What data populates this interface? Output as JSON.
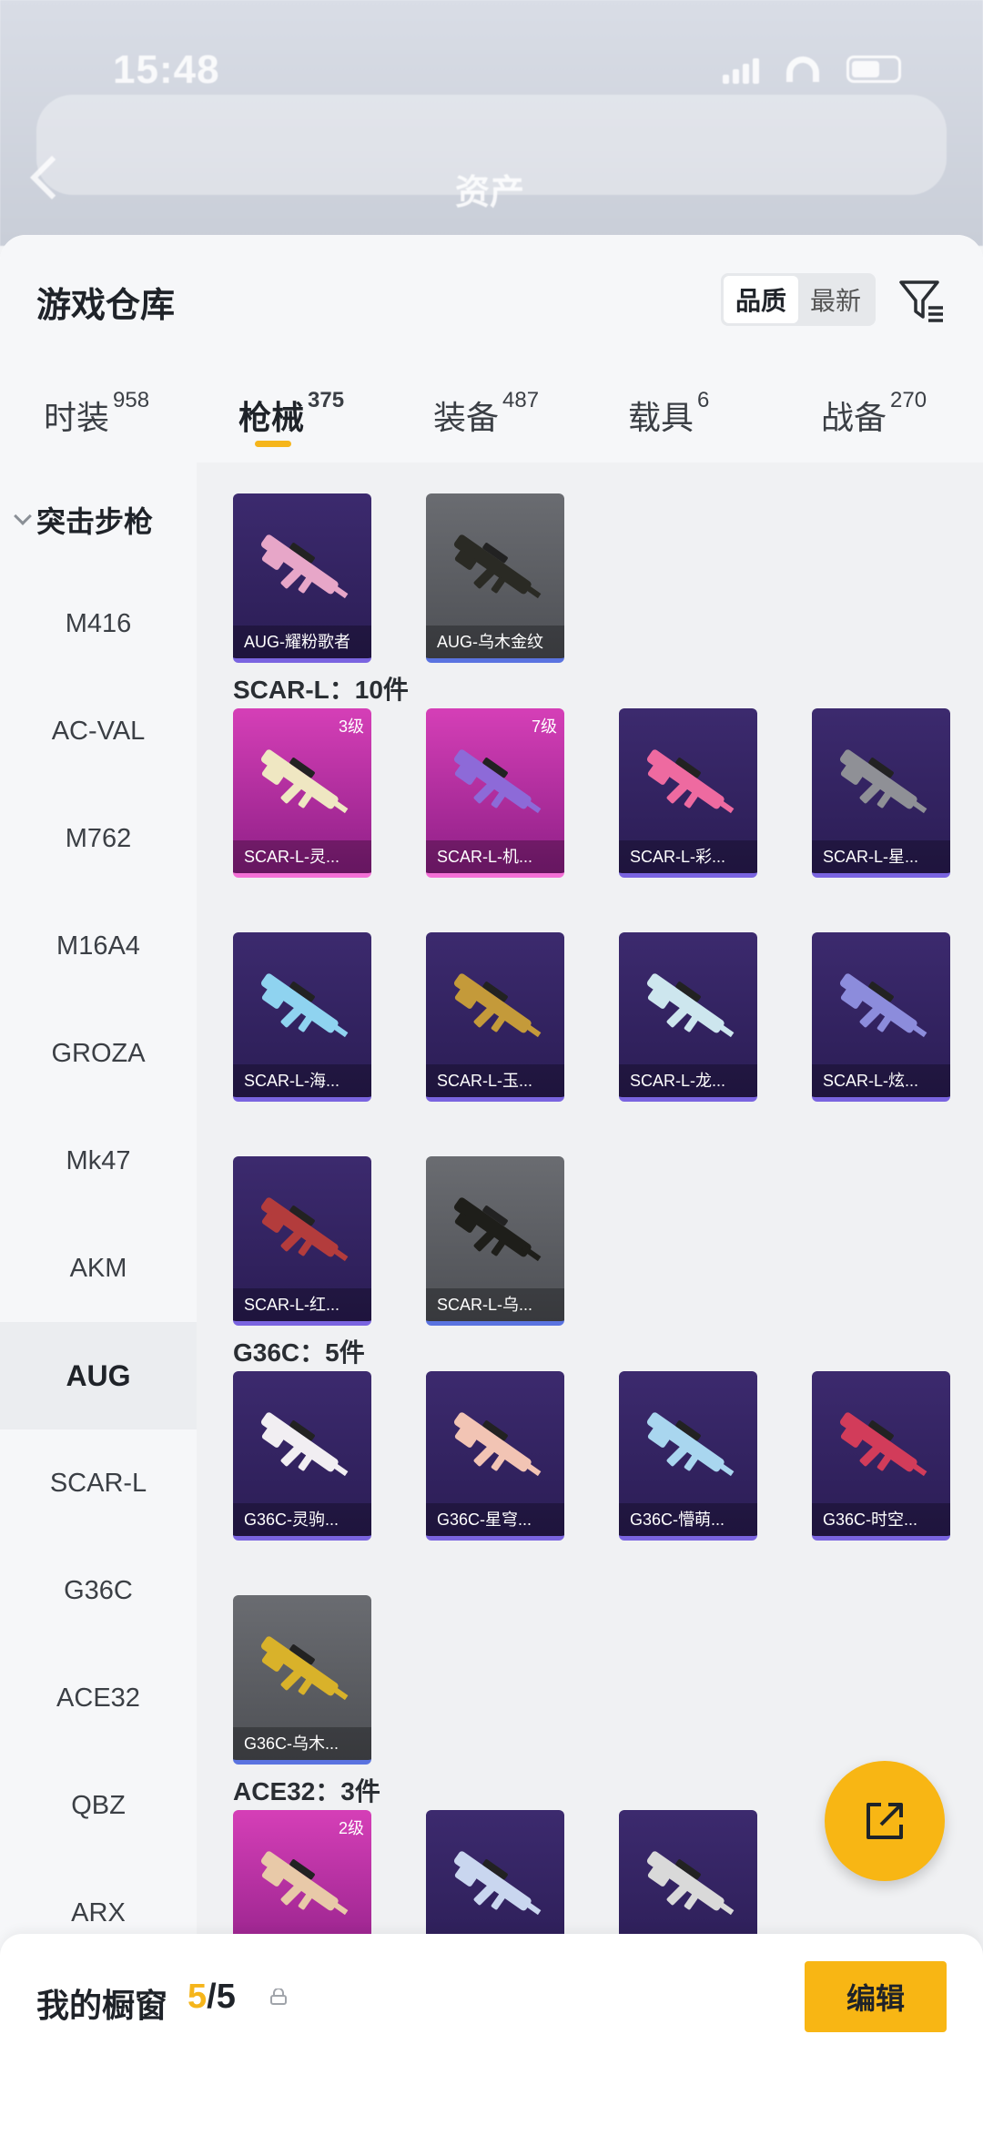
{
  "status_bar": {
    "time": "15:48"
  },
  "nav": {
    "title": "资产"
  },
  "header": {
    "title": "游戏仓库",
    "sort_options": [
      "品质",
      "最新"
    ],
    "active_sort": "品质"
  },
  "tabs": [
    {
      "label": "时装",
      "count": "958"
    },
    {
      "label": "枪械",
      "count": "375"
    },
    {
      "label": "装备",
      "count": "487"
    },
    {
      "label": "载具",
      "count": "6"
    },
    {
      "label": "战备",
      "count": "270"
    }
  ],
  "active_tab": "枪械",
  "sidebar": {
    "category": "突击步枪",
    "items": [
      "M416",
      "AC-VAL",
      "M762",
      "M16A4",
      "GROZA",
      "Mk47",
      "AKM",
      "AUG",
      "SCAR-L",
      "G36C",
      "ACE32",
      "QBZ",
      "ARX"
    ],
    "active": "AUG"
  },
  "groups": [
    {
      "title": "",
      "items": [
        {
          "name": "AUG-耀粉歌者",
          "level": "",
          "style": "purple",
          "gun_color": "#e7a6c8"
        },
        {
          "name": "AUG-乌木金纹",
          "level": "",
          "style": "gray",
          "gun_color": "#2a2a24"
        }
      ]
    },
    {
      "title": "SCAR-L：10件",
      "items": [
        {
          "name": "SCAR-L-灵...",
          "level": "3级",
          "style": "pink",
          "gun_color": "#efe7c2"
        },
        {
          "name": "SCAR-L-机...",
          "level": "7级",
          "style": "pink",
          "gun_color": "#8d6ad8"
        },
        {
          "name": "SCAR-L-彩...",
          "level": "",
          "style": "purple",
          "gun_color": "#ee6aa0"
        },
        {
          "name": "SCAR-L-星...",
          "level": "",
          "style": "purple",
          "gun_color": "#8f9096"
        },
        {
          "name": "SCAR-L-海...",
          "level": "",
          "style": "purple",
          "gun_color": "#8fd3f0"
        },
        {
          "name": "SCAR-L-玉...",
          "level": "",
          "style": "purple",
          "gun_color": "#c49a3a"
        },
        {
          "name": "SCAR-L-龙...",
          "level": "",
          "style": "purple",
          "gun_color": "#cde6ee"
        },
        {
          "name": "SCAR-L-炫...",
          "level": "",
          "style": "purple",
          "gun_color": "#8c8cdc"
        },
        {
          "name": "SCAR-L-红...",
          "level": "",
          "style": "purple",
          "gun_color": "#b33c3c"
        },
        {
          "name": "SCAR-L-乌...",
          "level": "",
          "style": "gray",
          "gun_color": "#1e1e1a"
        }
      ]
    },
    {
      "title": "G36C：5件",
      "items": [
        {
          "name": "G36C-灵驹...",
          "level": "",
          "style": "purple",
          "gun_color": "#f1eef2"
        },
        {
          "name": "G36C-星穹...",
          "level": "",
          "style": "purple",
          "gun_color": "#f2c4b4"
        },
        {
          "name": "G36C-懵萌...",
          "level": "",
          "style": "purple",
          "gun_color": "#a9d6ef"
        },
        {
          "name": "G36C-时空...",
          "level": "",
          "style": "purple",
          "gun_color": "#d23c5a"
        },
        {
          "name": "G36C-乌木...",
          "level": "",
          "style": "gray",
          "gun_color": "#d9b22a"
        }
      ]
    },
    {
      "title": "ACE32：3件",
      "items": [
        {
          "name": "",
          "level": "2级",
          "style": "pink",
          "gun_color": "#e8c9a8"
        },
        {
          "name": "",
          "level": "",
          "style": "purple",
          "gun_color": "#c9d6ef"
        },
        {
          "name": "",
          "level": "",
          "style": "purple",
          "gun_color": "#d9d9d9"
        }
      ]
    }
  ],
  "bottom": {
    "label": "我的橱窗",
    "current": "5",
    "total": "/5",
    "edit_label": "编辑"
  },
  "colors": {
    "accent": "#f8b614"
  }
}
